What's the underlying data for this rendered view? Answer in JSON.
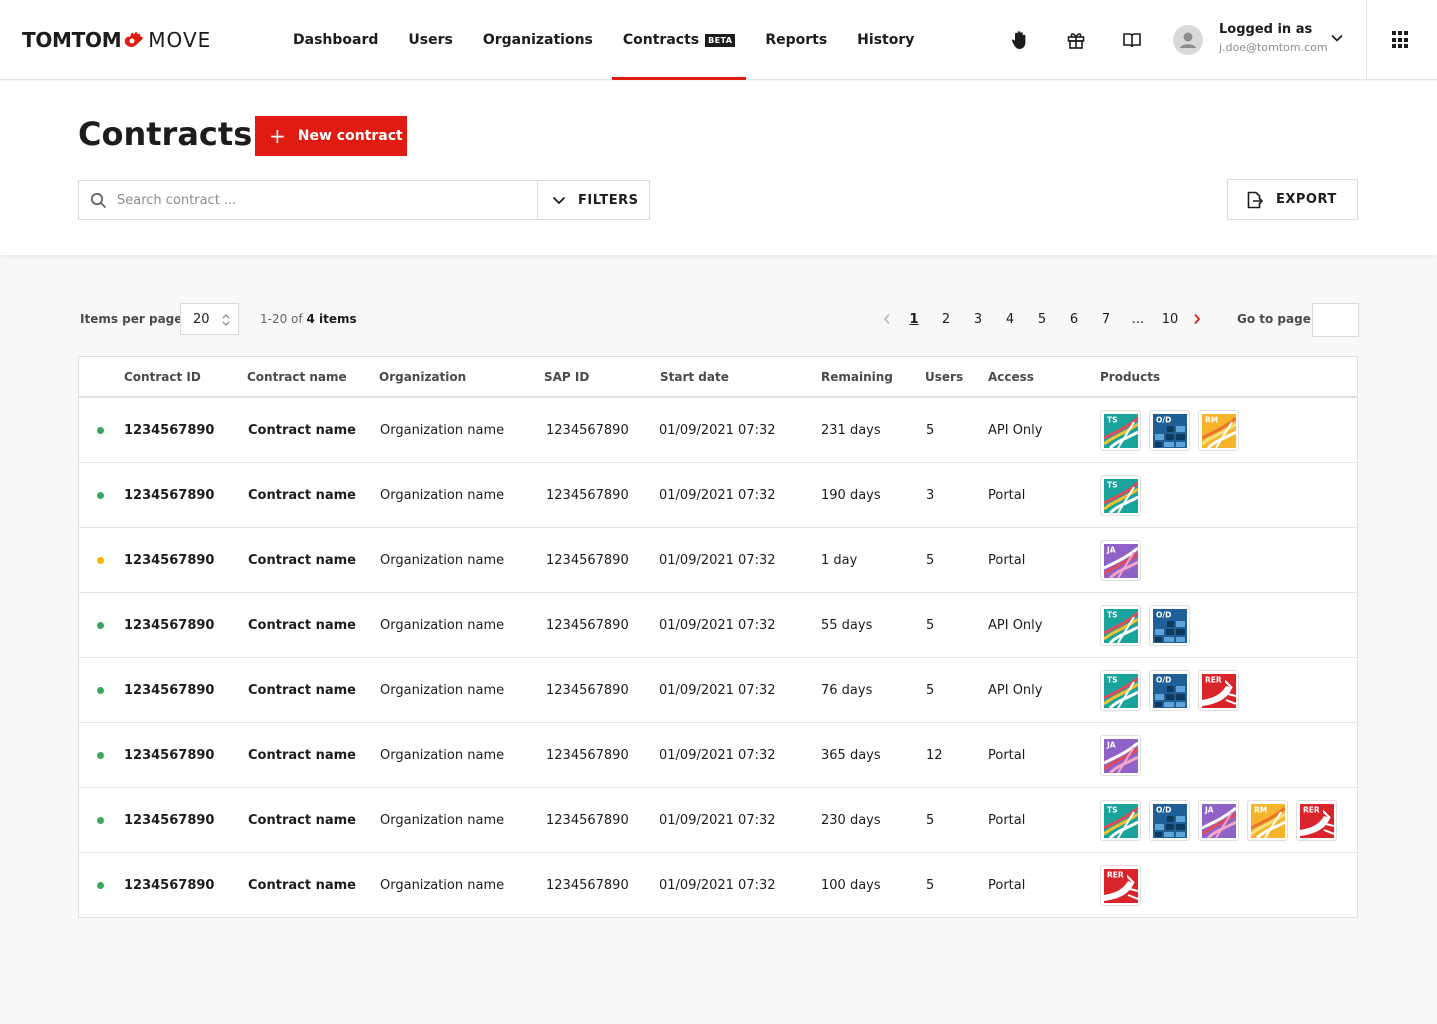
{
  "brand": {
    "name": "TOMTOM",
    "product": "MOVE"
  },
  "nav": [
    {
      "label": "Dashboard",
      "active": false
    },
    {
      "label": "Users",
      "active": false
    },
    {
      "label": "Organizations",
      "active": false
    },
    {
      "label": "Contracts",
      "active": true,
      "badge": "BETA"
    },
    {
      "label": "Reports",
      "active": false
    },
    {
      "label": "History",
      "active": false
    }
  ],
  "header": {
    "icons": [
      "hand-icon",
      "gift-icon",
      "book-icon"
    ],
    "login_title": "Logged in as",
    "login_email": "j.doe@tomtom.com"
  },
  "page": {
    "title": "Contracts",
    "new_button": "New contract",
    "search_placeholder": "Search contract ...",
    "filters_label": "FILTERS",
    "export_label": "EXPORT"
  },
  "pagination": {
    "items_per_page_label": "Items per page",
    "items_per_page": "20",
    "range": "1-20 of",
    "total": "4 items",
    "pages": [
      "1",
      "2",
      "3",
      "4",
      "5",
      "6",
      "7",
      "...",
      "10"
    ],
    "current_page": "1",
    "goto_label": "Go to page"
  },
  "table": {
    "columns": [
      "Contract ID",
      "Contract name",
      "Organization",
      "SAP ID",
      "Start date",
      "Remaining",
      "Users",
      "Access",
      "Products"
    ],
    "rows": [
      {
        "status": "active",
        "status_color": "#3aa660",
        "contract_id": "1234567890",
        "contract_name": "Contract name",
        "organization": "Organization name",
        "sap_id": "1234567890",
        "start_date": "01/09/2021 07:32",
        "remaining": "231 days",
        "users": "5",
        "access": "API Only",
        "products": [
          "TS",
          "O/D",
          "RM"
        ]
      },
      {
        "status": "active",
        "status_color": "#3aa660",
        "contract_id": "1234567890",
        "contract_name": "Contract name",
        "organization": "Organization name",
        "sap_id": "1234567890",
        "start_date": "01/09/2021 07:32",
        "remaining": "190 days",
        "users": "3",
        "access": "Portal",
        "products": [
          "TS"
        ]
      },
      {
        "status": "expiring",
        "status_color": "#f5b800",
        "contract_id": "1234567890",
        "contract_name": "Contract name",
        "organization": "Organization name",
        "sap_id": "1234567890",
        "start_date": "01/09/2021 07:32",
        "remaining": "1 day",
        "users": "5",
        "access": "Portal",
        "products": [
          "JA"
        ]
      },
      {
        "status": "active",
        "status_color": "#3aa660",
        "contract_id": "1234567890",
        "contract_name": "Contract name",
        "organization": "Organization name",
        "sap_id": "1234567890",
        "start_date": "01/09/2021 07:32",
        "remaining": "55 days",
        "users": "5",
        "access": "API Only",
        "products": [
          "TS",
          "O/D"
        ]
      },
      {
        "status": "active",
        "status_color": "#3aa660",
        "contract_id": "1234567890",
        "contract_name": "Contract name",
        "organization": "Organization name",
        "sap_id": "1234567890",
        "start_date": "01/09/2021 07:32",
        "remaining": "76 days",
        "users": "5",
        "access": "API Only",
        "products": [
          "TS",
          "O/D",
          "RER"
        ]
      },
      {
        "status": "active",
        "status_color": "#3aa660",
        "contract_id": "1234567890",
        "contract_name": "Contract name",
        "organization": "Organization name",
        "sap_id": "1234567890",
        "start_date": "01/09/2021 07:32",
        "remaining": "365 days",
        "users": "12",
        "access": "Portal",
        "products": [
          "JA"
        ]
      },
      {
        "status": "active",
        "status_color": "#3aa660",
        "contract_id": "1234567890",
        "contract_name": "Contract name",
        "organization": "Organization name",
        "sap_id": "1234567890",
        "start_date": "01/09/2021 07:32",
        "remaining": "230 days",
        "users": "5",
        "access": "Portal",
        "products": [
          "TS",
          "O/D",
          "JA",
          "RM",
          "RER"
        ]
      },
      {
        "status": "active",
        "status_color": "#3aa660",
        "contract_id": "1234567890",
        "contract_name": "Contract name",
        "organization": "Organization name",
        "sap_id": "1234567890",
        "start_date": "01/09/2021 07:32",
        "remaining": "100 days",
        "users": "5",
        "access": "Portal",
        "products": [
          "RER"
        ]
      }
    ]
  },
  "product_colors": {
    "TS": "#1aa39a",
    "O/D": "#1f5f95",
    "RM": "#f5b42a",
    "JA": "#8f62c8",
    "RER": "#d8242a"
  },
  "accent_color": "#df1b12"
}
